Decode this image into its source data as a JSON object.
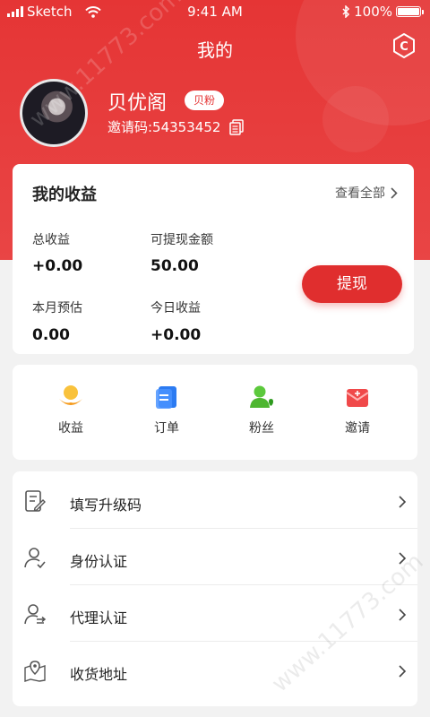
{
  "status_bar": {
    "carrier": "Sketch",
    "time": "9:41 AM",
    "battery": "100%",
    "battery_level": 1.0
  },
  "header": {
    "title": "我的",
    "username": "贝优阁",
    "badge": "贝粉",
    "invite_code": "邀请码:54353452"
  },
  "earnings": {
    "title": "我的收益",
    "view_all": "查看全部",
    "total_label": "总收益",
    "total_value": "+0.00",
    "withdrawable_label": "可提现金额",
    "withdrawable_value": "50.00",
    "month_label": "本月预估",
    "month_value": "0.00",
    "today_label": "今日收益",
    "today_value": "+0.00",
    "withdraw_button": "提现"
  },
  "shortcuts": [
    {
      "label": "收益",
      "icon": "earnings-icon"
    },
    {
      "label": "订单",
      "icon": "order-icon"
    },
    {
      "label": "粉丝",
      "icon": "fans-icon"
    },
    {
      "label": "邀请",
      "icon": "invite-icon"
    }
  ],
  "menu": [
    {
      "label": "填写升级码",
      "icon": "edit-form-icon"
    },
    {
      "label": "身份认证",
      "icon": "user-verify-icon"
    },
    {
      "label": "代理认证",
      "icon": "agent-icon"
    },
    {
      "label": "收货地址",
      "icon": "location-icon"
    }
  ],
  "watermark": "www.11773.com",
  "colors": {
    "brand": "#e53535",
    "button": "#e02e2e"
  }
}
